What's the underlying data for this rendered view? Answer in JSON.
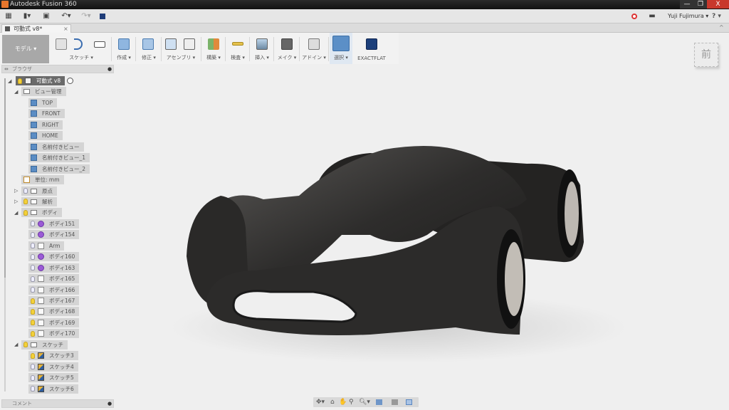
{
  "window": {
    "title": "Autodesk Fusion 360",
    "minimize": "—",
    "maximize": "❐",
    "close": "X"
  },
  "quickbar": {
    "user": "Yuji Fujimura ▾",
    "help": "? ▾",
    "icons": [
      "grid-icon",
      "file-icon",
      "save-icon",
      "undo-icon",
      "redo-icon",
      "sync-icon"
    ]
  },
  "tab": {
    "label": "可動式 v8*",
    "close": "×"
  },
  "ribbon": {
    "workspace": "モデル ▾",
    "groups": [
      "スケッチ ▾",
      "作成 ▾",
      "修正 ▾",
      "アセンブリ ▾",
      "構築 ▾",
      "検査 ▾",
      "挿入 ▾",
      "メイク ▾",
      "アドイン ▾",
      "選択 ▾",
      "EXACTFLAT"
    ]
  },
  "browser": {
    "title": "ブラウザ",
    "items": [
      {
        "label": "可動式 v8",
        "level": 0,
        "arrow": "◢",
        "bulb": "on",
        "icon": "comp",
        "root": true
      },
      {
        "label": "ビュー管理",
        "level": 1,
        "arrow": "◢",
        "icon": "folder"
      },
      {
        "label": "TOP",
        "level": 2,
        "icon": "view"
      },
      {
        "label": "FRONT",
        "level": 2,
        "icon": "view"
      },
      {
        "label": "RIGHT",
        "level": 2,
        "icon": "view"
      },
      {
        "label": "HOME",
        "level": 2,
        "icon": "view"
      },
      {
        "label": "名前付きビュー",
        "level": 2,
        "icon": "view"
      },
      {
        "label": "名前付きビュー_1",
        "level": 2,
        "icon": "view"
      },
      {
        "label": "名前付きビュー_2",
        "level": 2,
        "icon": "view"
      },
      {
        "label": "単位: mm",
        "level": 1,
        "icon": "unit"
      },
      {
        "label": "原点",
        "level": 1,
        "arrow": "▷",
        "bulb": "off",
        "icon": "folder"
      },
      {
        "label": "解析",
        "level": 1,
        "arrow": "▷",
        "bulb": "on",
        "icon": "folder"
      },
      {
        "label": "ボディ",
        "level": 1,
        "arrow": "◢",
        "bulb": "on",
        "icon": "folder"
      },
      {
        "label": "ボディ151",
        "level": 2,
        "bulb": "off",
        "icon": "bodyp"
      },
      {
        "label": "ボディ154",
        "level": 2,
        "bulb": "off",
        "icon": "bodyp"
      },
      {
        "label": "Arm",
        "level": 2,
        "bulb": "off",
        "icon": "body"
      },
      {
        "label": "ボディ160",
        "level": 2,
        "bulb": "off",
        "icon": "bodyp"
      },
      {
        "label": "ボディ163",
        "level": 2,
        "bulb": "off",
        "icon": "bodyp"
      },
      {
        "label": "ボディ165",
        "level": 2,
        "bulb": "off",
        "icon": "body"
      },
      {
        "label": "ボディ166",
        "level": 2,
        "bulb": "off",
        "icon": "body"
      },
      {
        "label": "ボディ167",
        "level": 2,
        "bulb": "on",
        "icon": "body"
      },
      {
        "label": "ボディ168",
        "level": 2,
        "bulb": "on",
        "icon": "body"
      },
      {
        "label": "ボディ169",
        "level": 2,
        "bulb": "on",
        "icon": "body"
      },
      {
        "label": "ボディ170",
        "level": 2,
        "bulb": "on",
        "icon": "body"
      },
      {
        "label": "スケッチ",
        "level": 1,
        "arrow": "◢",
        "bulb": "on",
        "icon": "folder"
      },
      {
        "label": "スケッチ3",
        "level": 2,
        "bulb": "on",
        "icon": "sketch"
      },
      {
        "label": "スケッチ4",
        "level": 2,
        "bulb": "off",
        "icon": "sketch"
      },
      {
        "label": "スケッチ5",
        "level": 2,
        "bulb": "off",
        "icon": "sketch"
      },
      {
        "label": "スケッチ6",
        "level": 2,
        "bulb": "off",
        "icon": "sketch"
      }
    ]
  },
  "comments": {
    "title": "コメント"
  },
  "viewcube": {
    "face": "前"
  },
  "colors": {
    "accent": "#4f86c1",
    "select": "#5b8fc7",
    "bulb_on": "#f3d13a",
    "body_purple": "#9b5bd6",
    "car": "#2b2a29"
  }
}
